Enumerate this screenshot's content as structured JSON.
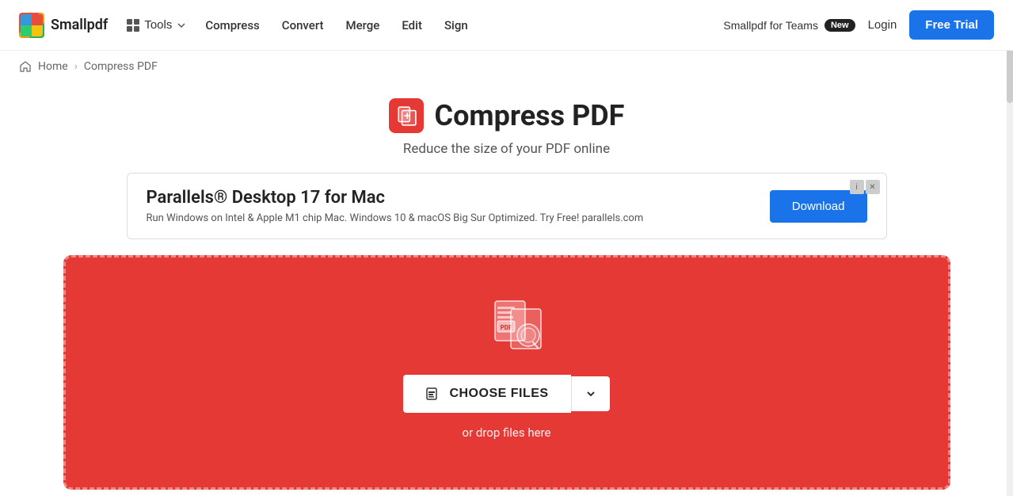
{
  "logo": {
    "text": "Smallpdf"
  },
  "navbar": {
    "tools_label": "Tools",
    "compress_label": "Compress",
    "convert_label": "Convert",
    "merge_label": "Merge",
    "edit_label": "Edit",
    "sign_label": "Sign",
    "teams_label": "Smallpdf for Teams",
    "new_badge": "New",
    "login_label": "Login",
    "free_trial_label": "Free Trial"
  },
  "breadcrumb": {
    "home": "Home",
    "current": "Compress PDF"
  },
  "page": {
    "title": "Compress PDF",
    "subtitle": "Reduce the size of your PDF online"
  },
  "ad": {
    "title": "Parallels® Desktop 17 for Mac",
    "description": "Run Windows on Intel & Apple M1 chip Mac. Windows 10 & macOS Big Sur Optimized. Try Free! parallels.com",
    "download_label": "Download"
  },
  "dropzone": {
    "choose_files_label": "CHOOSE FILES",
    "drop_text": "or drop files here",
    "file_icon": "📄"
  }
}
